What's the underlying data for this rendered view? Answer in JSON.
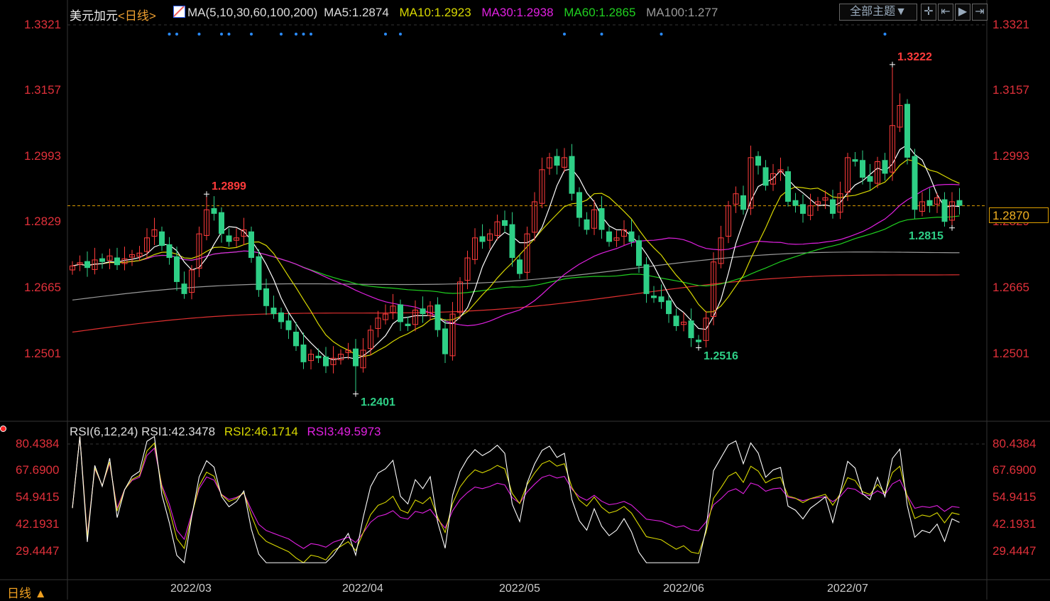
{
  "header": {
    "symbol": "美元加元",
    "period": "<日线>",
    "ma_title": "MA(5,10,30,60,100,200)",
    "ma5": "MA5:1.2874",
    "ma10": "MA10:1.2923",
    "ma30": "MA30:1.2938",
    "ma60": "MA60:1.2865",
    "ma100": "MA100:1.277"
  },
  "toolbar": {
    "theme_button": "全部主题▼",
    "icons": [
      "crosshair-icon",
      "range-icon",
      "play-icon",
      "exit-icon"
    ]
  },
  "rsi_header": {
    "title": "RSI(6,12,24)",
    "rsi1": "RSI1:42.3478",
    "rsi2": "RSI2:46.1714",
    "rsi3": "RSI3:49.5973"
  },
  "footer": {
    "period_label": "日线 ▲"
  },
  "colors": {
    "up": "#ff3b3b",
    "down": "#2ecf86",
    "ma5": "#ffffff",
    "ma10": "#d8d800",
    "ma30": "#e020e0",
    "ma60": "#20d020",
    "ma100": "#9a9a9a",
    "ma200": "#e03030"
  },
  "chart_data": {
    "type": "candlestick",
    "price_ticks": [
      "1.3321",
      "1.3157",
      "1.2993",
      "1.2829",
      "1.2665",
      "1.2501"
    ],
    "ylim": [
      1.2501,
      1.3321
    ],
    "rsi_ticks": [
      "80.4384",
      "67.6900",
      "54.9415",
      "42.1931",
      "29.4447"
    ],
    "rsi_ylim": [
      29.4447,
      80.4384
    ],
    "x_ticks": [
      {
        "label": "2022/03",
        "index": 16
      },
      {
        "label": "2022/04",
        "index": 39
      },
      {
        "label": "2022/05",
        "index": 60
      },
      {
        "label": "2022/06",
        "index": 82
      },
      {
        "label": "2022/07",
        "index": 104
      }
    ],
    "close": [
      1.272,
      1.2728,
      1.2715,
      1.2735,
      1.273,
      1.2745,
      1.2722,
      1.2738,
      1.2748,
      1.2752,
      1.279,
      1.281,
      1.277,
      1.274,
      1.268,
      1.265,
      1.271,
      1.28,
      1.286,
      1.285,
      1.28,
      1.278,
      1.279,
      1.281,
      1.274,
      1.266,
      1.262,
      1.26,
      1.258,
      1.256,
      1.252,
      1.248,
      1.25,
      1.249,
      1.247,
      1.249,
      1.25,
      1.251,
      1.247,
      1.251,
      1.256,
      1.259,
      1.26,
      1.262,
      1.258,
      1.257,
      1.261,
      1.26,
      1.262,
      1.256,
      1.25,
      1.26,
      1.268,
      1.274,
      1.279,
      1.278,
      1.28,
      1.283,
      1.282,
      1.274,
      1.27,
      1.28,
      1.288,
      1.296,
      1.299,
      1.297,
      1.299,
      1.29,
      1.284,
      1.281,
      1.286,
      1.281,
      1.278,
      1.279,
      1.281,
      1.278,
      1.272,
      1.265,
      1.264,
      1.263,
      1.26,
      1.257,
      1.258,
      1.254,
      1.253,
      1.259,
      1.273,
      1.279,
      1.287,
      1.29,
      1.286,
      1.299,
      1.297,
      1.292,
      1.295,
      1.296,
      1.288,
      1.287,
      1.285,
      1.287,
      1.288,
      1.289,
      1.285,
      1.29,
      1.299,
      1.298,
      1.294,
      1.293,
      1.298,
      1.295,
      1.307,
      1.312,
      1.299,
      1.286,
      1.288,
      1.287,
      1.289,
      1.283,
      1.288,
      1.287
    ],
    "extremes": [
      {
        "index": 18,
        "type": "high",
        "value": 1.2899,
        "label": "1.2899"
      },
      {
        "index": 38,
        "type": "low",
        "value": 1.2401,
        "label": "1.2401"
      },
      {
        "index": 84,
        "type": "low",
        "value": 1.2516,
        "label": "1.2516"
      },
      {
        "index": 110,
        "type": "high",
        "value": 1.3222,
        "label": "1.3222"
      },
      {
        "index": 118,
        "type": "low",
        "value": 1.2815,
        "label": "1.2815"
      }
    ],
    "ma100_range": [
      1.2635,
      1.276
    ],
    "ma200_range": [
      1.2555,
      1.2705
    ],
    "last_price": "1.2870",
    "signal_indices": [
      13,
      14,
      17,
      20,
      21,
      24,
      28,
      30,
      31,
      32,
      42,
      44,
      66,
      71,
      79,
      109
    ]
  }
}
